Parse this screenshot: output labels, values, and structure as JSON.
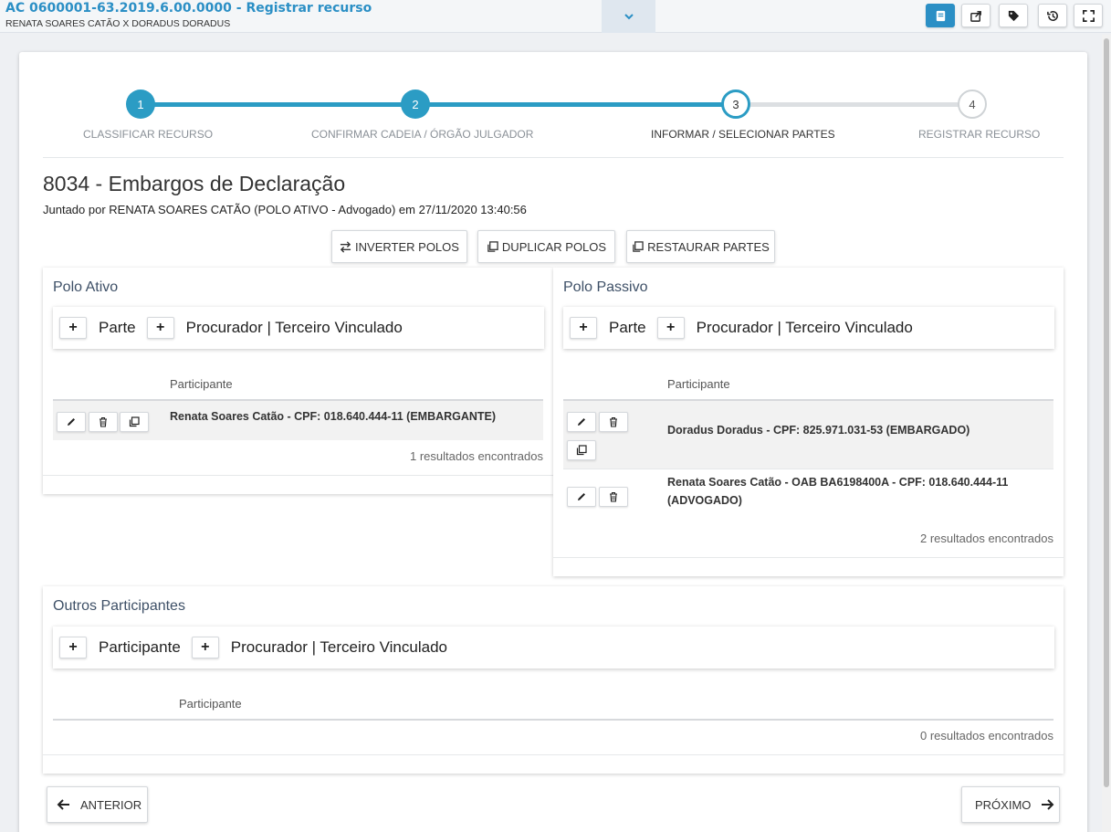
{
  "header": {
    "title": "AC 0600001-63.2019.6.00.0000 - Registrar recurso",
    "subtitle": "RENATA SOARES CATÃO X DORADUS DORADUS",
    "toolbar_icons": [
      "book-icon",
      "share-icon",
      "tag-icon",
      "history-icon",
      "fullscreen-icon"
    ]
  },
  "stepper": {
    "steps": [
      {
        "number": "1",
        "label": "CLASSIFICAR RECURSO",
        "state": "done"
      },
      {
        "number": "2",
        "label": "CONFIRMAR CADEIA / ÓRGÃO JULGADOR",
        "state": "done"
      },
      {
        "number": "3",
        "label": "INFORMAR / SELECIONAR PARTES",
        "state": "current"
      },
      {
        "number": "4",
        "label": "REGISTRAR RECURSO",
        "state": "todo"
      }
    ]
  },
  "document": {
    "heading": "8034 - Embargos de Declaração",
    "meta": "Juntado por RENATA SOARES CATÃO (POLO ATIVO - Advogado) em 27/11/2020 13:40:56"
  },
  "actions": {
    "invert": "INVERTER POLOS",
    "duplicate": "DUPLICAR POLOS",
    "restore": "RESTAURAR PARTES"
  },
  "polo_ativo": {
    "title": "Polo Ativo",
    "add_primary": "Parte",
    "add_secondary": "Procurador | Terceiro Vinculado",
    "column": "Participante",
    "rows": [
      {
        "text": "Renata Soares Catão - CPF: 018.640.444-11 (EMBARGANTE)"
      }
    ],
    "count": "1 resultados encontrados"
  },
  "polo_passivo": {
    "title": "Polo Passivo",
    "add_primary": "Parte",
    "add_secondary": "Procurador | Terceiro Vinculado",
    "column": "Participante",
    "rows": [
      {
        "text": "Doradus Doradus - CPF: 825.971.031-53 (EMBARGADO)"
      },
      {
        "line1": "Renata Soares Catão - OAB BA6198400A - CPF: 018.640.444-11",
        "line2": "(ADVOGADO)"
      }
    ],
    "count": "2 resultados encontrados"
  },
  "outros": {
    "title": "Outros Participantes",
    "add_primary": "Participante",
    "add_secondary": "Procurador | Terceiro Vinculado",
    "column": "Participante",
    "count": "0 resultados encontrados"
  },
  "navigation": {
    "previous": "ANTERIOR",
    "next": "PRÓXIMO"
  },
  "colors": {
    "accent": "#2b9cc4",
    "title_blue": "#2b8fc5",
    "panel_title": "#3e5067"
  }
}
